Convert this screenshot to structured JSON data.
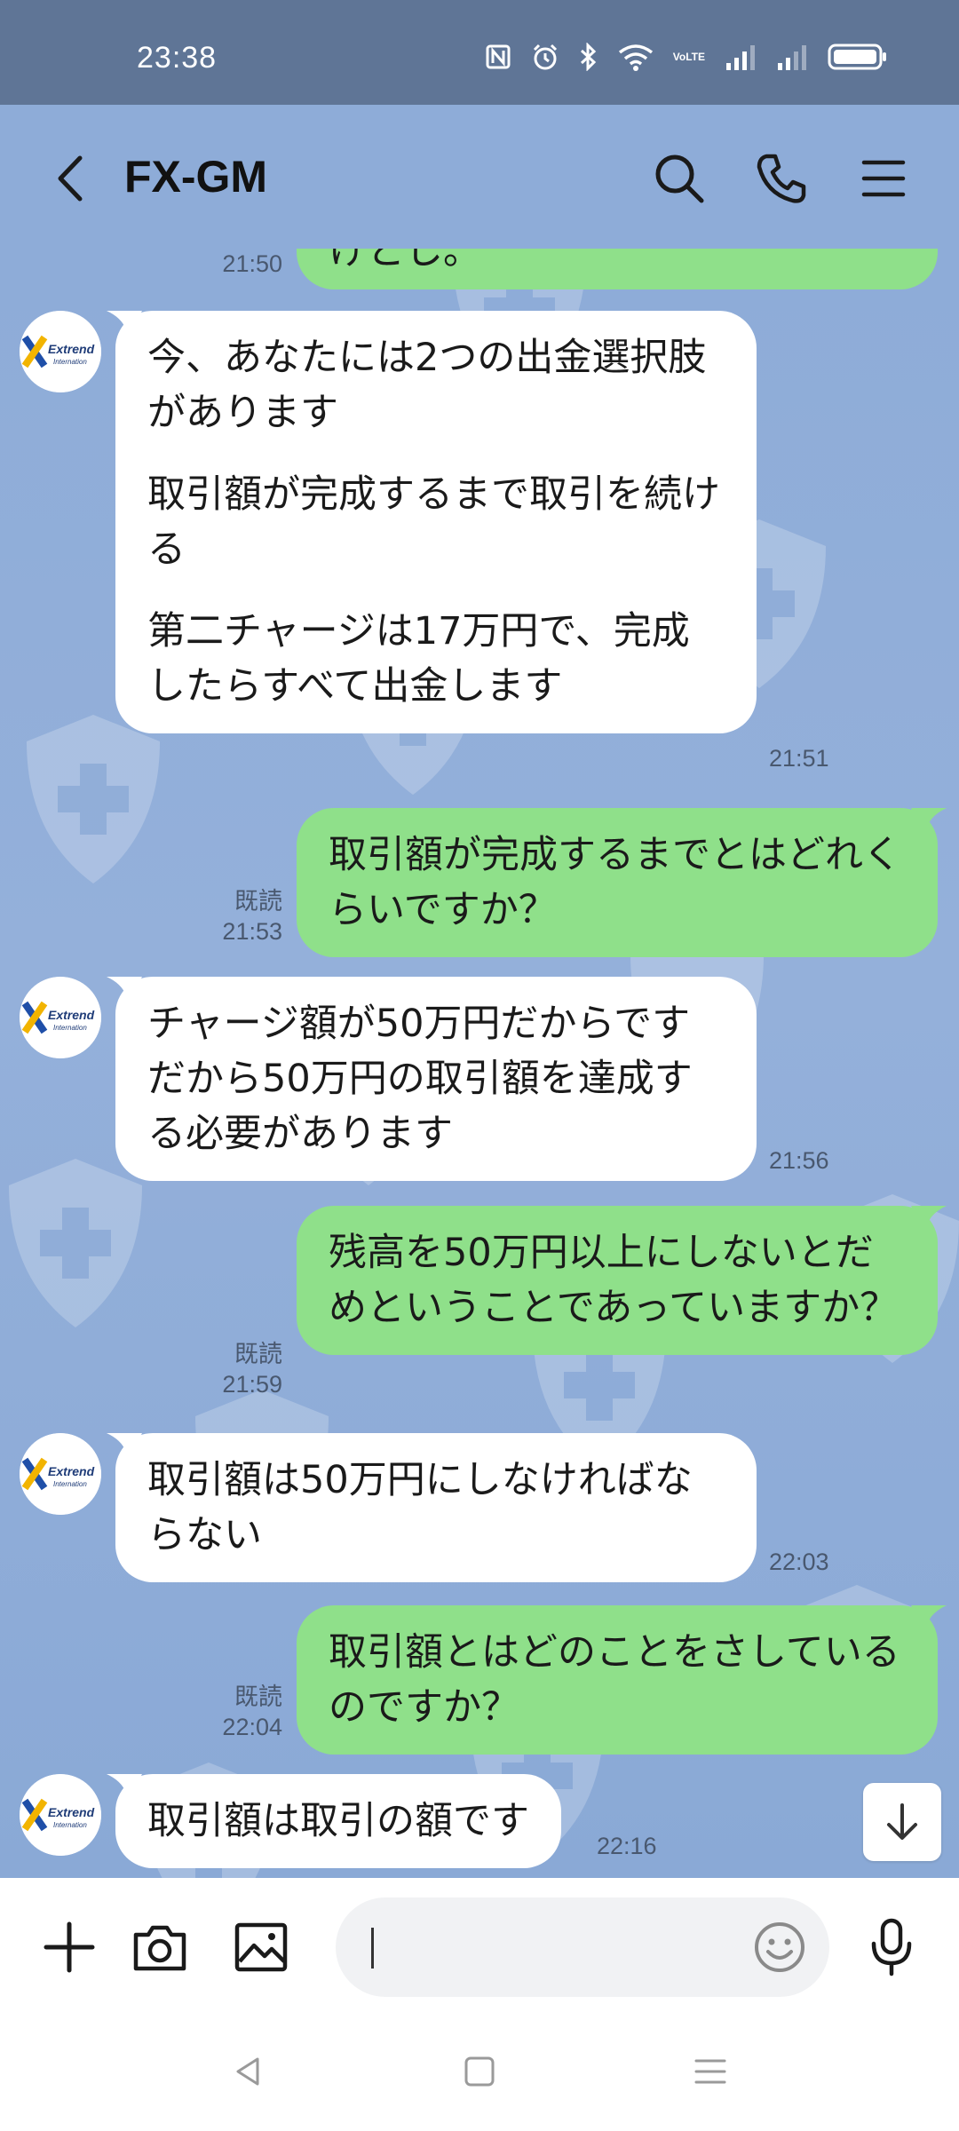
{
  "status_bar": {
    "time": "23:38",
    "icons": [
      "nfc-icon",
      "alarm-icon",
      "bluetooth-icon",
      "wifi-icon",
      "volte-icon",
      "signal-icon",
      "signal-icon",
      "battery-icon"
    ],
    "volte_text": "VoLTE"
  },
  "header": {
    "title": "FX-GM",
    "icons": [
      "back-icon",
      "search-icon",
      "phone-icon",
      "menu-icon"
    ]
  },
  "contact": {
    "avatar_text_1": "Extrend",
    "avatar_text_2": "Internation"
  },
  "messages": [
    {
      "side": "out",
      "paragraphs": [
        "けとし。"
      ],
      "time": "21:50",
      "read": ""
    },
    {
      "side": "in",
      "paragraphs": [
        "今、あなたには2つの出金選択肢があります",
        "取引額が完成するまで取引を続ける",
        "第二チャージは17万円で、完成したらすべて出金します"
      ],
      "time": "21:51"
    },
    {
      "side": "out",
      "paragraphs": [
        "取引額が完成するまでとはどれくらいですか？"
      ],
      "time": "21:53",
      "read": "既読"
    },
    {
      "side": "in",
      "paragraphs": [
        "チャージ額が50万円だからですだから50万円の取引額を達成する必要があります"
      ],
      "time": "21:56"
    },
    {
      "side": "out",
      "paragraphs": [
        "残高を50万円以上にしないとだめということであっていますか？"
      ],
      "time": "21:59",
      "read": "既読"
    },
    {
      "side": "in",
      "paragraphs": [
        "取引額は50万円にしなければならない"
      ],
      "time": "22:03"
    },
    {
      "side": "out",
      "paragraphs": [
        "取引額とはどのことをさしているのですか？"
      ],
      "time": "22:04",
      "read": "既読"
    },
    {
      "side": "in",
      "paragraphs": [
        "取引額は取引の額です"
      ],
      "time": "22:16"
    }
  ],
  "input_bar": {
    "icons": [
      "plus-icon",
      "camera-icon",
      "image-icon",
      "emoji-icon",
      "mic-icon"
    ],
    "value": ""
  },
  "scroll_button": {
    "icon": "arrow-down-icon"
  },
  "nav_bar": {
    "icons": [
      "nav-back-icon",
      "nav-home-icon",
      "nav-recents-icon"
    ]
  },
  "colors": {
    "status_bar": "#5f7596",
    "chat_background": "#8eacd8",
    "outgoing_bubble": "#8fe08a",
    "incoming_bubble": "#ffffff",
    "timestamp": "#49586f"
  }
}
